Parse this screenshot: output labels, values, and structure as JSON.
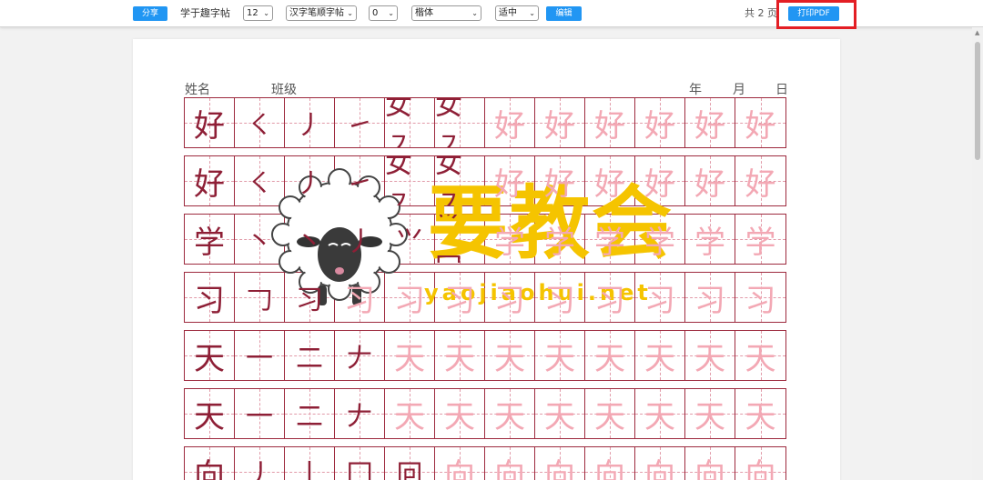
{
  "toolbar": {
    "share_label": "分享",
    "template_label": "学于趣字帖",
    "size_value": "12",
    "type_value": "汉字笔顺字帖",
    "count_value": "0",
    "font_value": "楷体",
    "fit_value": "适中",
    "edit_label": "编辑",
    "pages_text": "共 2 页",
    "print_label": "打印PDF"
  },
  "sheet": {
    "name_label": "姓名",
    "class_label": "班级",
    "year_label": "年",
    "month_label": "月",
    "day_label": "日",
    "rows": [
      {
        "model": "好",
        "strokes": [
          "㇛",
          "㇓",
          "㇀",
          "女㇇",
          "女㇇",
          "好"
        ]
      },
      {
        "model": "好",
        "strokes": [
          "㇛",
          "㇓",
          "㇀",
          "女㇇",
          "女㇇",
          "好"
        ]
      },
      {
        "model": "学",
        "strokes": [
          "丶",
          "丶",
          "丿",
          "⺍",
          "⺍冖",
          "学"
        ]
      },
      {
        "model": "习",
        "strokes": [
          "𠃌",
          "习",
          "习"
        ]
      },
      {
        "model": "天",
        "strokes": [
          "一",
          "二",
          "𠂇",
          "天"
        ]
      },
      {
        "model": "天",
        "strokes": [
          "一",
          "二",
          "𠂇",
          "天"
        ]
      },
      {
        "model": "向",
        "strokes": [
          "丿",
          "丨",
          "冂",
          "冋",
          "向"
        ]
      }
    ]
  },
  "watermark": {
    "title": "要教会",
    "url": "yaojiaohui.net"
  },
  "colors": {
    "accent": "#2196f3",
    "grid": "#9d2a3e",
    "model_char": "#8e1f36",
    "trace_char": "#f3a8b4",
    "highlight": "#e31e24",
    "watermark": "#f5c400"
  }
}
